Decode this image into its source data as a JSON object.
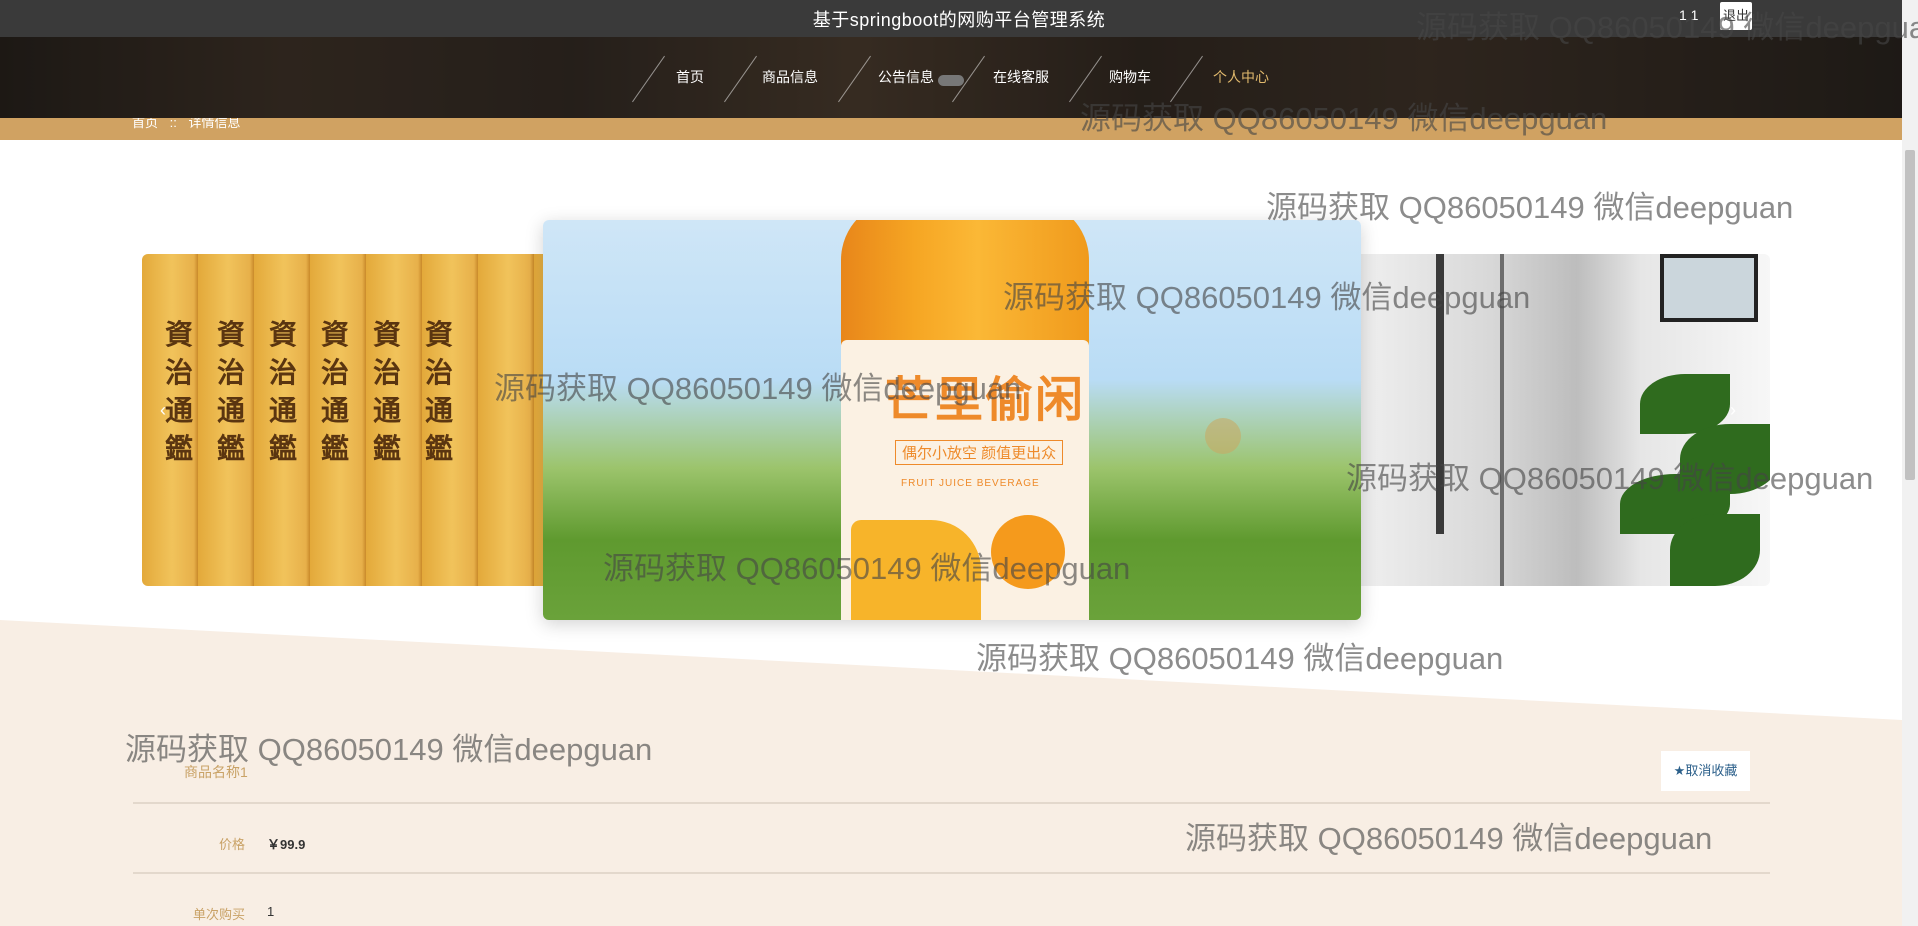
{
  "header": {
    "site_title": "基于springboot的网购平台管理系统",
    "user_info": "1 1",
    "logout_label": "退出"
  },
  "nav": {
    "items": [
      "首页",
      "商品信息",
      "公告信息",
      "在线客服",
      "购物车",
      "个人中心"
    ],
    "active": "个人中心"
  },
  "breadcrumb": {
    "home": "首页",
    "sep": "::",
    "current": "详情信息"
  },
  "carousel": {
    "center_label_cn": "芒里偷闲",
    "center_sub": "偶尔小放空 颜值更出众",
    "center_en": "FRUIT JUICE BEVERAGE",
    "left_book_text": "資治通鑑",
    "prev_icon": "chevron-left-icon",
    "next_icon": "chevron-right-icon"
  },
  "product": {
    "name": "商品名称1",
    "favorite_label": "★取消收藏",
    "fields": [
      {
        "label": "价格",
        "value": "￥99.9"
      },
      {
        "label": "单次购买",
        "value": "1"
      }
    ]
  },
  "watermark": "源码获取 QQ86050149 微信deepguan",
  "colors": {
    "accent_gold": "#d0a262",
    "topbar": "#3a3a3a",
    "detail_bg": "#f8eee4",
    "active_nav": "#e1b96d"
  }
}
